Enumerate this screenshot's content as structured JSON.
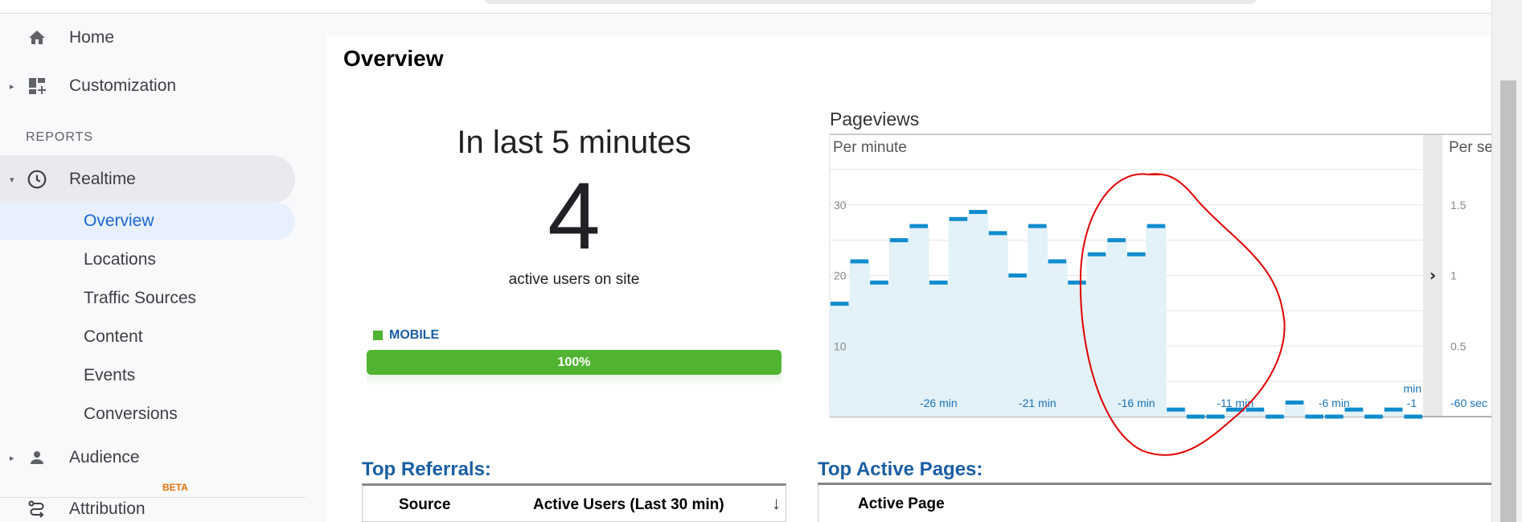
{
  "sidebar": {
    "home": "Home",
    "customization": "Customization",
    "reports_header": "REPORTS",
    "realtime": "Realtime",
    "realtime_items": [
      "Overview",
      "Locations",
      "Traffic Sources",
      "Content",
      "Events",
      "Conversions"
    ],
    "audience": "Audience",
    "attribution": "Attribution",
    "attribution_badge": "BETA"
  },
  "main": {
    "title": "Overview",
    "realtime_summary": {
      "heading": "In last 5 minutes",
      "active_users": "4",
      "active_label": "active users on site"
    },
    "device": {
      "label": "MOBILE",
      "percent_text": "100%",
      "fraction": 1.0,
      "color": "#50b432"
    },
    "pageviews": {
      "title": "Pageviews",
      "per_minute_label": "Per minute",
      "per_second_label": "Per se"
    },
    "top_referrals": {
      "title": "Top Referrals:",
      "columns": [
        "Source",
        "Active Users (Last 30 min)"
      ]
    },
    "top_active_pages": {
      "title": "Top Active Pages:",
      "columns": [
        "Active Page"
      ]
    }
  },
  "chart_data": {
    "type": "bar",
    "title": "Pageviews",
    "ylabel": "Per minute",
    "y_ticks": [
      "10",
      "20",
      "30"
    ],
    "ylim": [
      0,
      40
    ],
    "x_ticks": [
      "-26 min",
      "-21 min",
      "-16 min",
      "-11 min",
      "-6 min",
      "-1"
    ],
    "x_unit_label": "min",
    "values": [
      16,
      22,
      19,
      25,
      27,
      19,
      28,
      29,
      26,
      20,
      27,
      22,
      19,
      23,
      25,
      23,
      27,
      1,
      0,
      0,
      1,
      1,
      0,
      2,
      0,
      0,
      1,
      0,
      1,
      0
    ],
    "right_axis": {
      "label": "Per se",
      "ticks": [
        "0.5",
        "1",
        "1.5"
      ],
      "x_label": "-60 sec"
    },
    "colors": {
      "line": "#0f8ccd",
      "fill": "#e3f1f8"
    }
  }
}
